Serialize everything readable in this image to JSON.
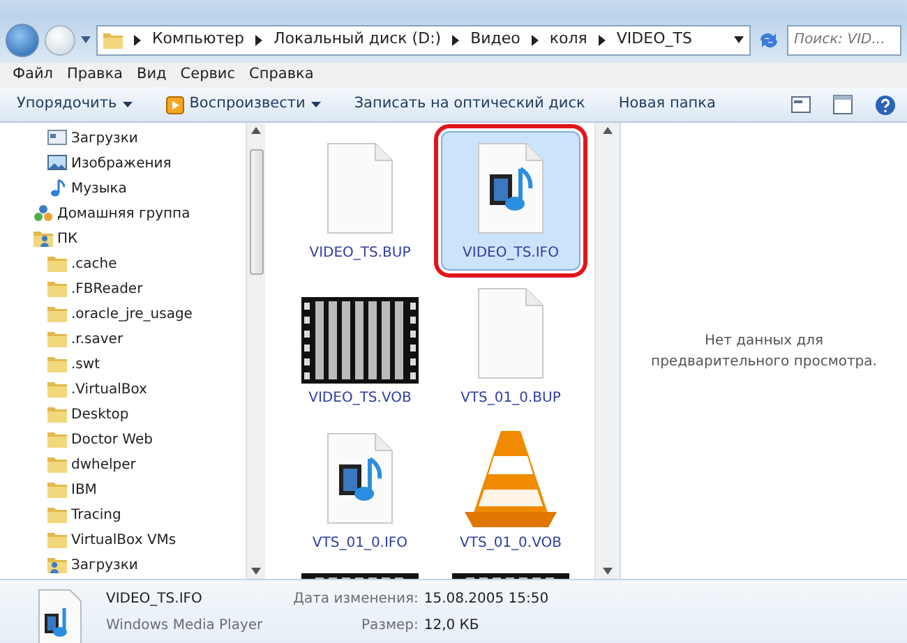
{
  "address_bar": {
    "path": [
      "Компьютер",
      "Локальный диск (D:)",
      "Видео",
      "коля",
      "VIDEO_TS"
    ]
  },
  "search": {
    "placeholder": "Поиск: VID..."
  },
  "menu": [
    "Файл",
    "Правка",
    "Вид",
    "Сервис",
    "Справка"
  ],
  "toolbar": [
    {
      "label": "Упорядочить",
      "kind": "dropdown"
    },
    {
      "label": "Воспроизвести",
      "kind": "play"
    },
    {
      "label": "Записать на оптический диск",
      "kind": "plain"
    },
    {
      "label": "Новая папка",
      "kind": "plain"
    }
  ],
  "sidebar": {
    "items": [
      {
        "children": [
          {
            "label": "Загрузки",
            "kind": "downloads"
          },
          {
            "label": "Изображения",
            "kind": "pictures"
          },
          {
            "label": "Музыка",
            "kind": "music"
          }
        ]
      },
      {
        "label": "Домашняя группа",
        "kind": "homegroup"
      },
      {
        "label": "ПК",
        "kind": "pc",
        "children": [
          {
            "label": ".cache",
            "kind": "folder"
          },
          {
            "label": ".FBReader",
            "kind": "folder"
          },
          {
            "label": ".oracle_jre_usage",
            "kind": "folder"
          },
          {
            "label": ".r.saver",
            "kind": "folder"
          },
          {
            "label": ".swt",
            "kind": "folder"
          },
          {
            "label": ".VirtualBox",
            "kind": "folder"
          },
          {
            "label": "Desktop",
            "kind": "folder"
          },
          {
            "label": "Doctor Web",
            "kind": "folder"
          },
          {
            "label": "dwhelper",
            "kind": "folder"
          },
          {
            "label": "IBM",
            "kind": "folder"
          },
          {
            "label": "Tracing",
            "kind": "folder"
          },
          {
            "label": "VirtualBox VMs",
            "kind": "folder"
          },
          {
            "label": "Загрузки",
            "kind": "userfolder"
          }
        ]
      }
    ]
  },
  "files": [
    {
      "name": "VIDEO_TS.BUP",
      "kind": "blank",
      "selected": false,
      "highlighted": false
    },
    {
      "name": "VIDEO_TS.IFO",
      "kind": "media",
      "selected": true,
      "highlighted": true
    },
    {
      "name": "VIDEO_TS.VOB",
      "kind": "video",
      "selected": false,
      "highlighted": false
    },
    {
      "name": "VTS_01_0.BUP",
      "kind": "blank",
      "selected": false,
      "highlighted": false
    },
    {
      "name": "VTS_01_0.IFO",
      "kind": "media",
      "selected": false,
      "highlighted": false
    },
    {
      "name": "VTS_01_0.VOB",
      "kind": "vlc",
      "selected": false,
      "highlighted": false
    },
    {
      "kind": "video",
      "selected": false,
      "highlighted": false
    },
    {
      "kind": "video",
      "selected": false,
      "highlighted": false
    }
  ],
  "preview": {
    "message": "Нет данных для предварительного просмотра."
  },
  "details": {
    "name": "VIDEO_TS.IFO",
    "type": "Windows Media Player",
    "fields": [
      {
        "label": "Дата изменения:",
        "value": "15.08.2005 15:50"
      },
      {
        "label": "Размер:",
        "value": "12,0 КБ"
      }
    ]
  }
}
